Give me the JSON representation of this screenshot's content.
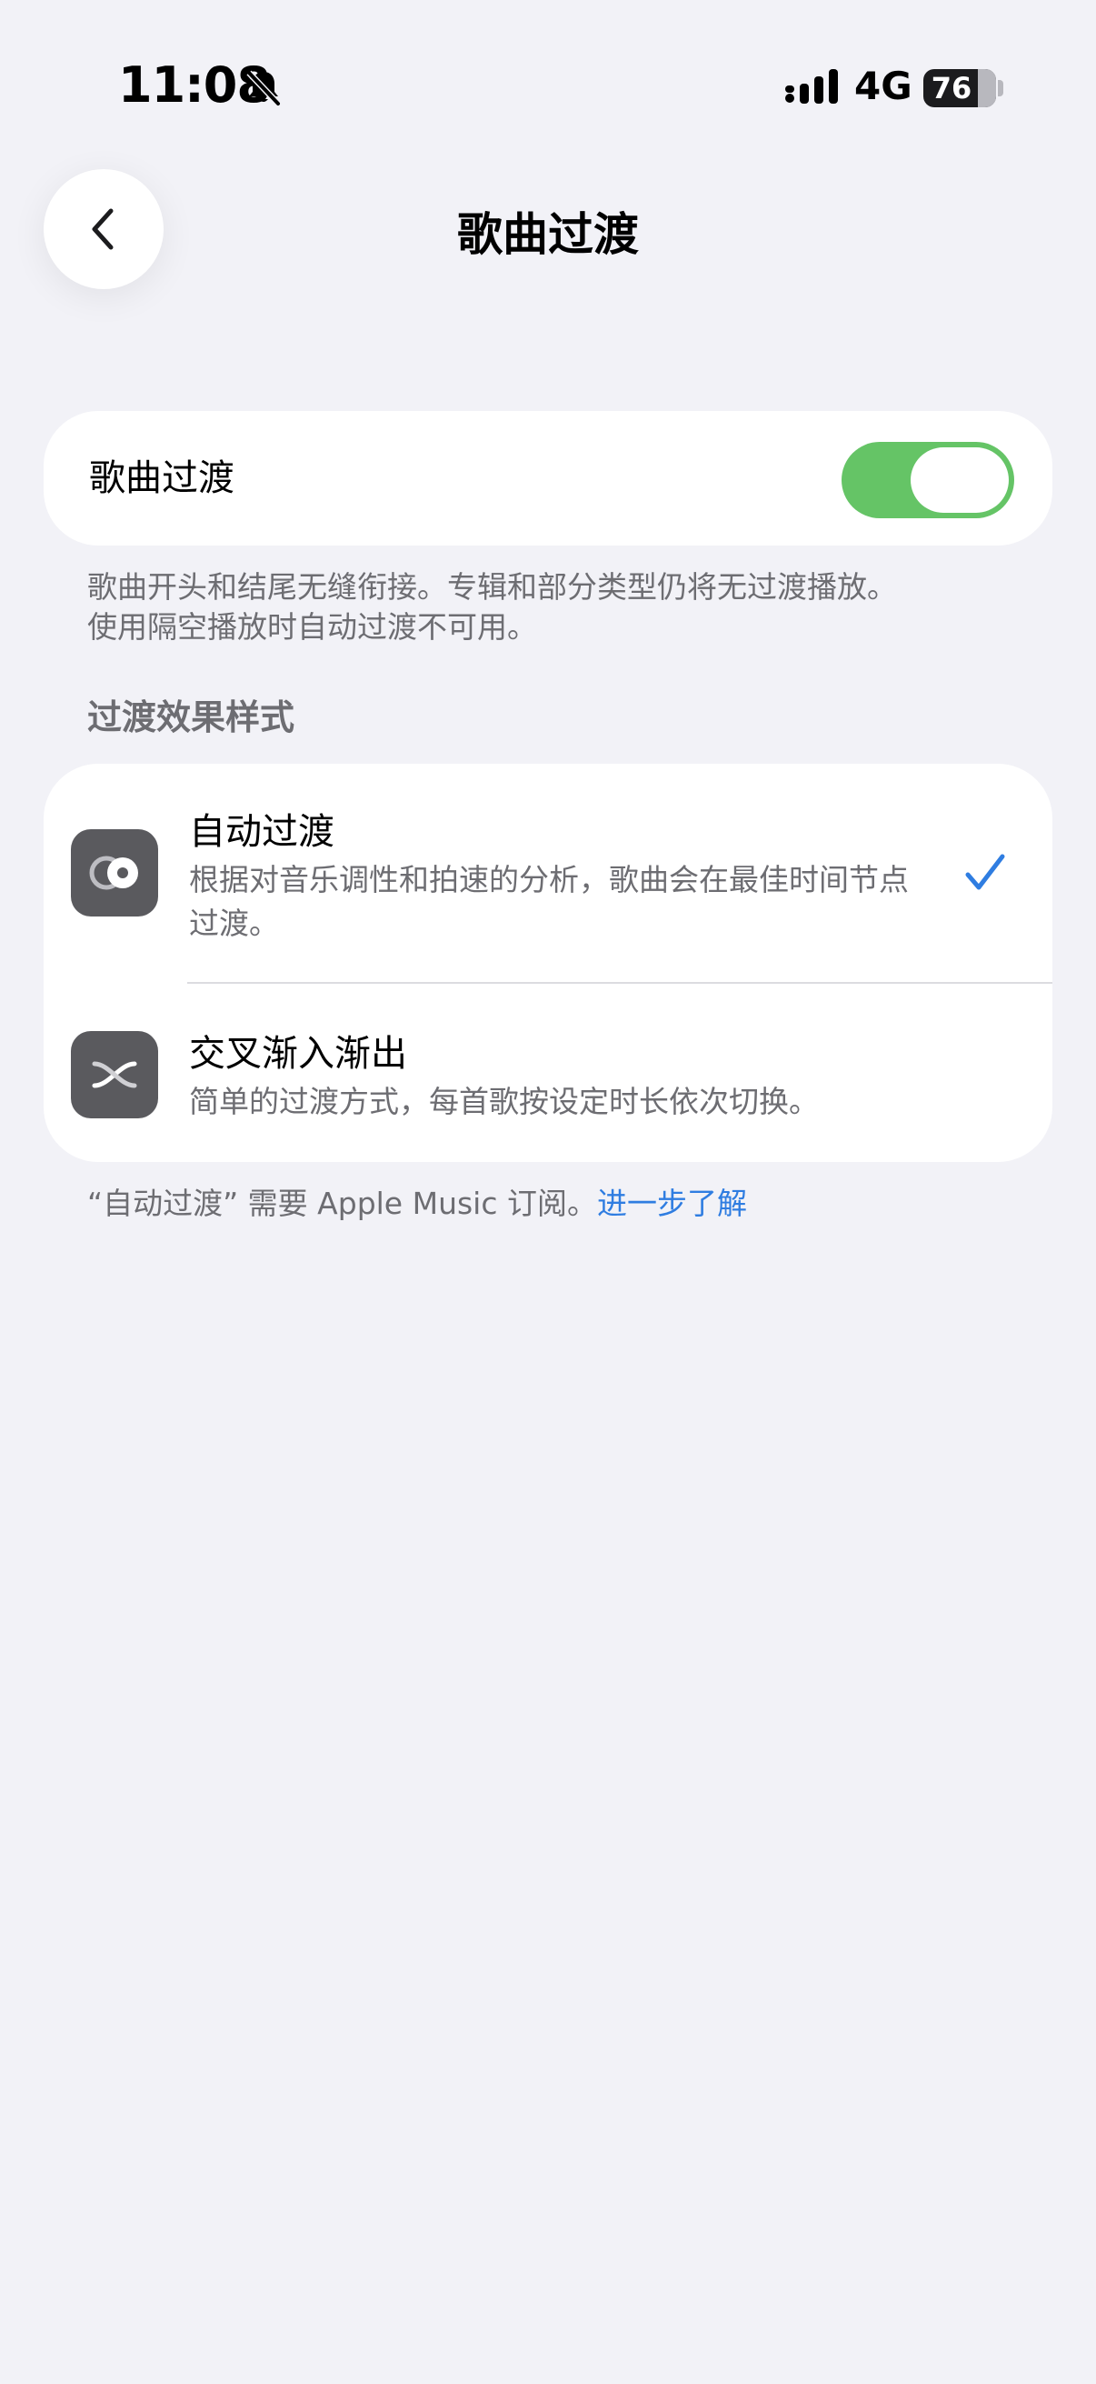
{
  "status_bar": {
    "time": "11:08",
    "mute_icon": "bell-slash-icon",
    "signal_icon": "cellular-signal-icon",
    "network": "4G",
    "battery": "76"
  },
  "nav": {
    "back_icon": "chevron-left-icon",
    "title": "歌曲过渡"
  },
  "toggle": {
    "label": "歌曲过渡",
    "on": true,
    "on_color": "#65c466"
  },
  "toggle_footnote": {
    "line1": "歌曲开头和结尾无缝衔接。专辑和部分类型仍将无过渡播放。",
    "line2": "使用隔空播放时自动过渡不可用。"
  },
  "section_header": "过渡效果样式",
  "options": [
    {
      "icon": "auto-transition-icon",
      "title": "自动过渡",
      "description": "根据对音乐调性和拍速的分析，歌曲会在最佳时间节点过渡。",
      "selected": true
    },
    {
      "icon": "crossfade-icon",
      "title": "交叉渐入渐出",
      "description": "简单的过渡方式，每首歌按设定时长依次切换。",
      "selected": false
    }
  ],
  "checkmark_icon": "checkmark-icon",
  "bottom_note": {
    "text": "“自动过渡” 需要 Apple Music 订阅。",
    "link": "进一步了解",
    "link_color": "#2f7de1"
  }
}
